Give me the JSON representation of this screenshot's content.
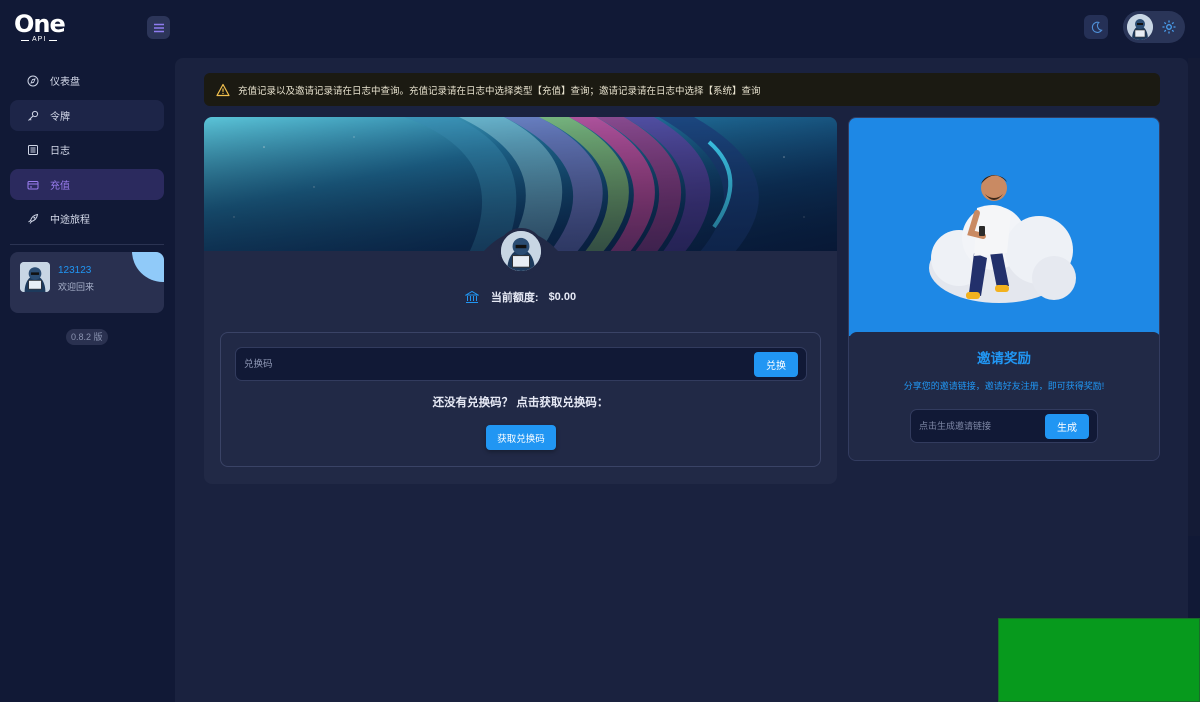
{
  "header": {
    "logo_main": "One",
    "logo_sub": "API",
    "icons": {
      "menu": "menu-icon",
      "theme": "moon-icon",
      "settings": "gear-icon"
    }
  },
  "sidebar": {
    "items": [
      {
        "label": "仪表盘",
        "icon": "dashboard-icon",
        "active": false
      },
      {
        "label": "令牌",
        "icon": "key-icon",
        "active": false
      },
      {
        "label": "日志",
        "icon": "log-icon",
        "active": false
      },
      {
        "label": "充值",
        "icon": "wallet-icon",
        "active": true
      },
      {
        "label": "中途旅程",
        "icon": "rocket-icon",
        "active": false
      }
    ],
    "user": {
      "name": "123123",
      "welcome": "欢迎回来"
    },
    "version": "0.8.2 版"
  },
  "alert": {
    "text": "充值记录以及邀请记录请在日志中查询。充值记录请在日志中选择类型【充值】查询；邀请记录请在日志中选择【系统】查询"
  },
  "topup": {
    "balance_label": "当前额度:",
    "balance_value": "$0.00",
    "code_placeholder": "兑换码",
    "redeem_button": "兑换",
    "no_code_text": "还没有兑换码？ 点击获取兑换码：",
    "get_code_button": "获取兑换码"
  },
  "invite": {
    "title": "邀请奖励",
    "subtitle": "分享您的邀请链接，邀请好友注册，即可获得奖励!",
    "link_placeholder": "点击生成邀请链接",
    "generate_button": "生成"
  },
  "colors": {
    "accent": "#2196f3",
    "active_nav": "#9b7df0",
    "background": "#111936",
    "panel": "#1a223f",
    "card": "#212946"
  }
}
